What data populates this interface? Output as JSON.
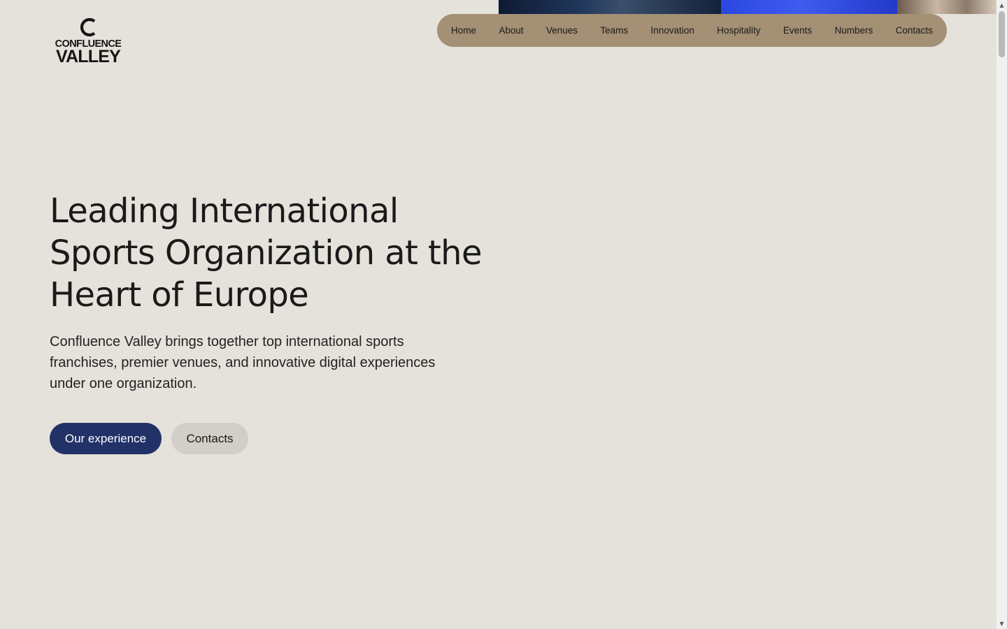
{
  "brand": {
    "line1": "CONFLUENCE",
    "line2": "VALLEY",
    "color": "#151515"
  },
  "nav": {
    "items": [
      {
        "label": "Home"
      },
      {
        "label": "About"
      },
      {
        "label": "Venues"
      },
      {
        "label": "Teams"
      },
      {
        "label": "Innovation"
      },
      {
        "label": "Hospitality"
      },
      {
        "label": "Events"
      },
      {
        "label": "Numbers"
      },
      {
        "label": "Contacts"
      }
    ],
    "background": "#a39075"
  },
  "hero": {
    "title": "Leading International Sports Organization at the Heart of Europe",
    "description": "Confluence Valley brings together top international sports franchises, premier venues, and innovative digital experiences under one organization.",
    "primary_button": "Our experience",
    "secondary_button": "Contacts"
  },
  "colors": {
    "page_background": "#e5e2db",
    "primary_button": "#223268",
    "secondary_button": "#d2cfc9"
  },
  "scrollbar": {
    "up_icon": "triangle-up-icon",
    "down_icon": "triangle-down-icon"
  }
}
